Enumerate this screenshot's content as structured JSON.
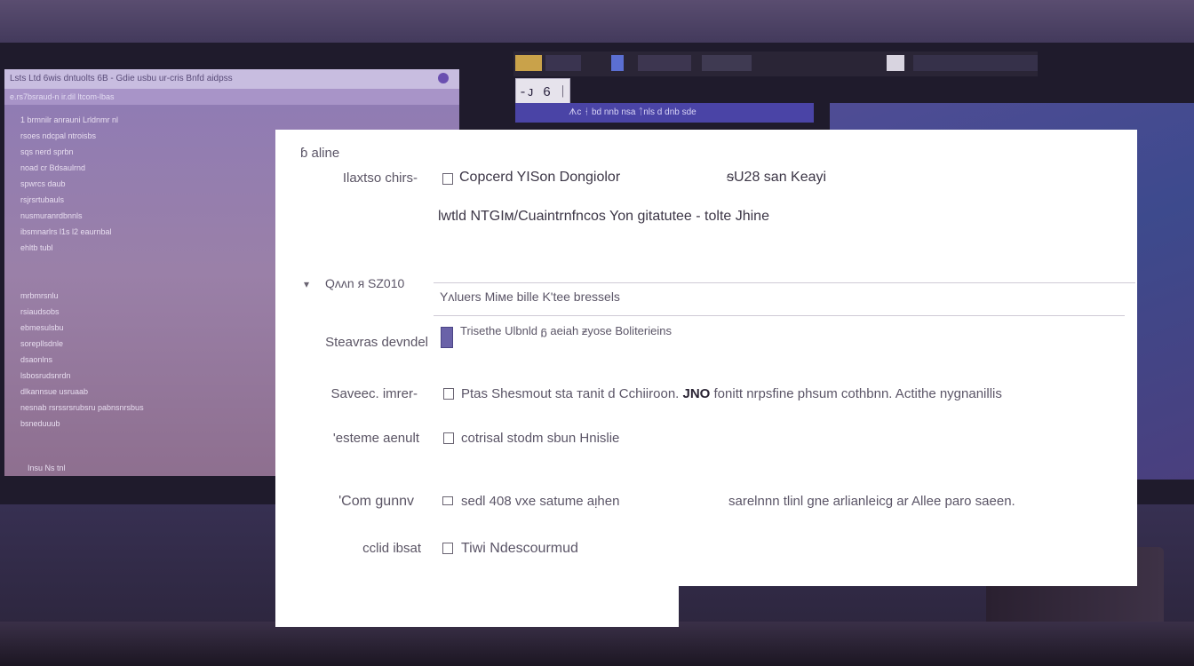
{
  "background": {
    "tag_text": "-ᴊ 6 ᛁ",
    "left_window": {
      "title": "Lsts Ltd 6wis dntuolts 6B - Gdie usbu   ur-cris  Bnfd aidpss",
      "toolbar": "e.rs7bsraud-n ir.dil    ltcom-lbas",
      "rows": [
        "1 brmnilr anrauni  Lrldnmr nl",
        "rsoes ndcpal ntroisbs",
        "     sqs nerd sprbn",
        "noad cr  Bdsaulrnd",
        "       spwrcs daub",
        "       rsjrsrtubauls",
        "       nusmuranrdbnnls",
        "ibsmnarlrs  l1s  l2  eaurnbal",
        "            ehltb tubl",
        "",
        "",
        "         mrbmrsnlu",
        "         rsiaudsobs",
        "         ebmesulsbu",
        "         sorepllsdnle",
        "         dsaonlns",
        "         lsbosrudsnrdn",
        "         dlkannsue usruaab",
        "nesnab   rsrssrsrubsru  pabnsnrsbus",
        "         bsneduuub"
      ],
      "footer": "Insu  Ns    tnl"
    },
    "blue_bar_text": "ᗑc ᚽ bd nnb nsa  ᛏnls  d dnb sde"
  },
  "dialog": {
    "header": "ɓ aline",
    "rows": [
      {
        "label": "Ilaxtso chirs-",
        "value": "Copcerd YISon Dongiolor",
        "extra": "ᵴU28 san Keayi"
      },
      {
        "value": "lwtld NTGIᴍ/Cuaintrnfncos Yon gitatutee  -  tolte Jhine"
      },
      {
        "label": "Qᴧᴧn  ᴙ SZ010",
        "value": "Yᴧluers  Miᴍe bille  K'tee bressels"
      },
      {
        "label": "Steavras devndel",
        "value": "Trisethe Ulbnld  ᵷ aeiah ᵶyose Boliterieins"
      },
      {
        "label": "Saveec. imrer-",
        "value": "Ptas Shesmout sta ᴛanit d  Cchiiroon.",
        "bold": "JNO",
        "value2": "fonitt nrpsfine phsum cothbnn. Actithe nygnanillis"
      },
      {
        "label": "'esteme aenult",
        "value": "cotrisal stodm sbun  Hnislie"
      },
      {
        "label": "'Com gunnv",
        "value": "sedl 408 vxe satume aᴉhen",
        "extra": "sarelnnn tlinl gne arlianleicg ar Allee paro saeen."
      },
      {
        "label": "cclid ibsat",
        "value": "Tiwi Ndescourmud"
      }
    ]
  }
}
